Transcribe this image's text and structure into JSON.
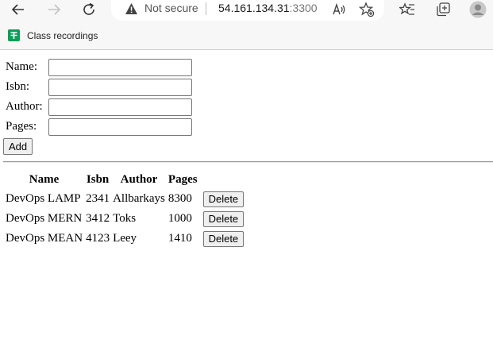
{
  "browser": {
    "security_label": "Not secure",
    "url_host": "54.161.134.31",
    "url_port": ":3300",
    "bookmark_label": "Class recordings"
  },
  "form": {
    "name_label": "Name:",
    "isbn_label": "Isbn:",
    "author_label": "Author:",
    "pages_label": "Pages:",
    "add_label": "Add"
  },
  "table": {
    "headers": [
      "Name",
      "Isbn",
      "Author",
      "Pages"
    ],
    "rows": [
      {
        "name": "DevOps LAMP",
        "isbn": "2341",
        "author": "Allbarkays",
        "pages": "8300",
        "action": "Delete"
      },
      {
        "name": "DevOps MERN",
        "isbn": "3412",
        "author": "Toks",
        "pages": "1000",
        "action": "Delete"
      },
      {
        "name": "DevOps MEAN",
        "isbn": "4123",
        "author": "Leey",
        "pages": "1410",
        "action": "Delete"
      }
    ]
  },
  "colors": {
    "chrome_bg": "#f7f7f7",
    "bookmark_icon": "#0f9d58"
  }
}
